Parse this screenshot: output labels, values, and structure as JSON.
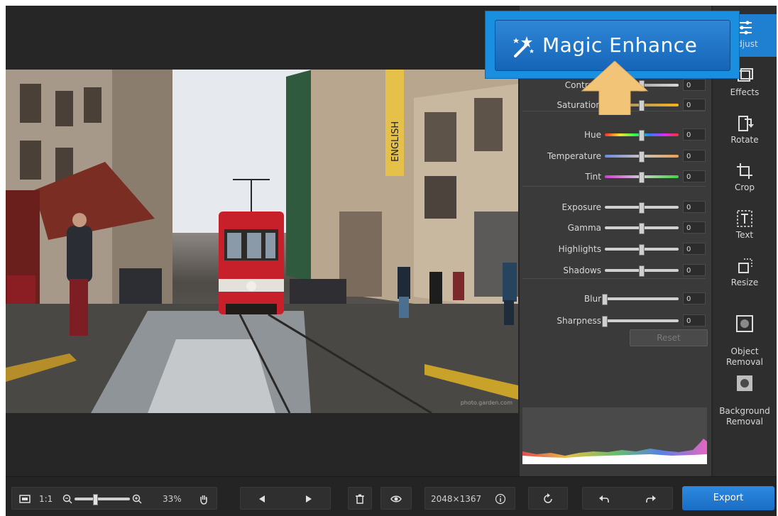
{
  "magic_enhance": {
    "label": "Magic Enhance"
  },
  "adjust": {
    "sliders": [
      {
        "label": "Contrast",
        "value": "0",
        "level": 0.5
      },
      {
        "label": "Saturation",
        "value": "0",
        "level": 0.5
      },
      {
        "label": "Hue",
        "value": "0",
        "level": 0.5
      },
      {
        "label": "Temperature",
        "value": "0",
        "level": 0.5
      },
      {
        "label": "Tint",
        "value": "0",
        "level": 0.5
      },
      {
        "label": "Exposure",
        "value": "0",
        "level": 0.5
      },
      {
        "label": "Gamma",
        "value": "0",
        "level": 0.5
      },
      {
        "label": "Highlights",
        "value": "0",
        "level": 0.5
      },
      {
        "label": "Shadows",
        "value": "0",
        "level": 0.5
      },
      {
        "label": "Blur",
        "value": "0",
        "level": 0.0
      },
      {
        "label": "Sharpness",
        "value": "0",
        "level": 0.0
      }
    ],
    "reset_label": "Reset"
  },
  "tools": {
    "adjust": "Adjust",
    "effects": "Effects",
    "rotate": "Rotate",
    "crop": "Crop",
    "text": "Text",
    "resize": "Resize",
    "object_removal": "Object\nRemoval",
    "background_removal": "Background\nRemoval"
  },
  "photo": {
    "sign_text": "ENGLISH",
    "watermark": "photo.garden.com"
  },
  "toolbar": {
    "one_to_one": "1:1",
    "zoom_percent": "33%",
    "zoom_level": 0.33,
    "dimensions": "2048×1367",
    "export_label": "Export"
  },
  "colors": {
    "accent": "#1f7fd0",
    "panel": "#3a3a3a",
    "arrow": "#f2c477"
  }
}
